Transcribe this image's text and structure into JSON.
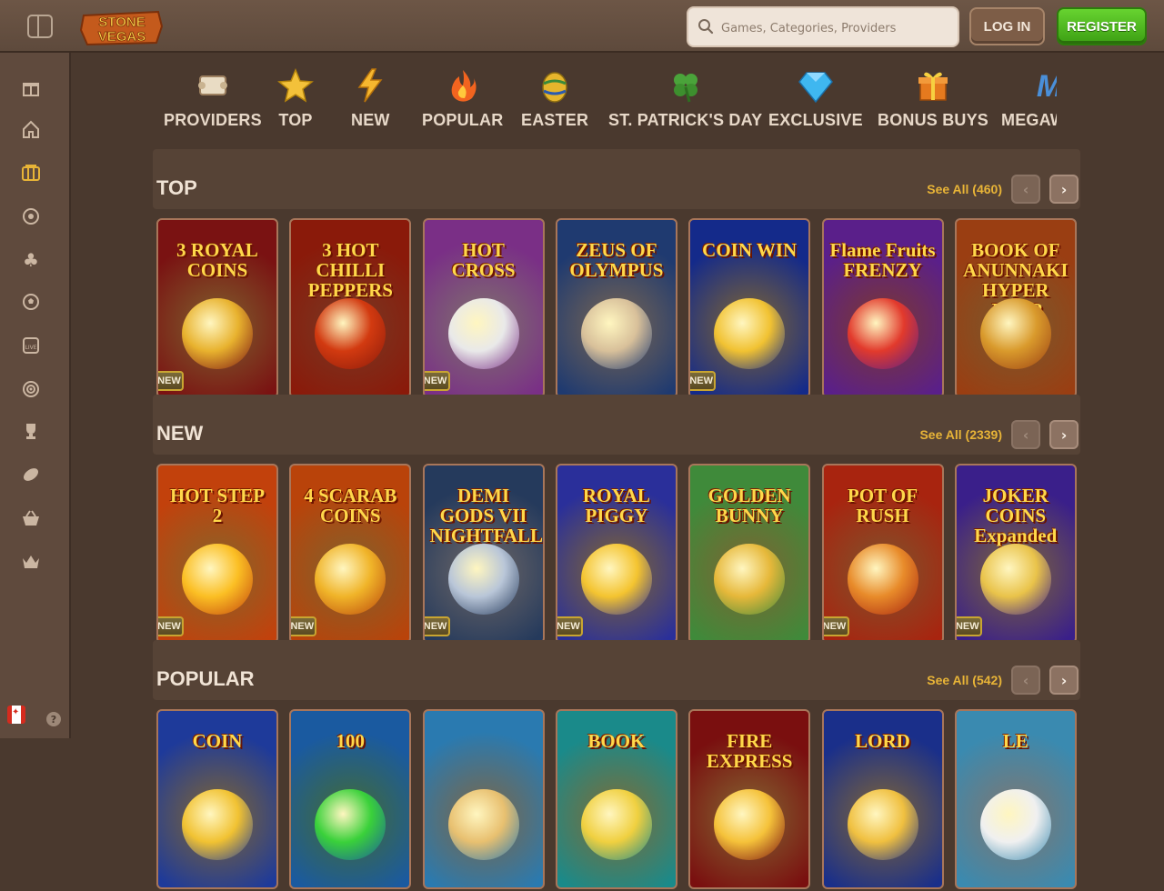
{
  "header": {
    "logo_text": "STONE VEGAS",
    "search_placeholder": "Games, Categories, Providers",
    "login_label": "LOG IN",
    "register_label": "REGISTER"
  },
  "sidebar": {
    "items": [
      {
        "name": "gift-icon"
      },
      {
        "name": "home-icon"
      },
      {
        "name": "slots-icon"
      },
      {
        "name": "roulette-icon"
      },
      {
        "name": "clover-icon"
      },
      {
        "name": "football-icon"
      },
      {
        "name": "live-casino-icon"
      },
      {
        "name": "target-icon"
      },
      {
        "name": "trophy-icon"
      },
      {
        "name": "rugby-icon"
      },
      {
        "name": "basket-icon"
      },
      {
        "name": "crown-icon"
      }
    ],
    "help_label": "?"
  },
  "categories": [
    {
      "label": "PROVIDERS",
      "icon": "scroll-icon"
    },
    {
      "label": "TOP",
      "icon": "star-icon"
    },
    {
      "label": "NEW",
      "icon": "lightning-icon"
    },
    {
      "label": "POPULAR",
      "icon": "fire-icon"
    },
    {
      "label": "EASTER",
      "icon": "egg-icon"
    },
    {
      "label": "ST. PATRICK'S DAY",
      "icon": "shamrock-icon"
    },
    {
      "label": "EXCLUSIVE",
      "icon": "diamond-icon"
    },
    {
      "label": "BONUS BUYS",
      "icon": "gift-box-icon"
    },
    {
      "label": "MEGAWAYS",
      "icon": "megaways-icon"
    }
  ],
  "sections": [
    {
      "title": "TOP",
      "see_all": "See All (460)",
      "games": [
        {
          "title": "3 ROYAL COINS",
          "badge": "NEW",
          "bg": "#7a1212",
          "accent": "#e8b22e"
        },
        {
          "title": "3 HOT CHILLI PEPPERS",
          "badge": "",
          "bg": "#8a1a0a",
          "accent": "#d23a10"
        },
        {
          "title": "HOT CROSS",
          "badge": "NEW",
          "bg": "#7a2f86",
          "accent": "#e9e9e9"
        },
        {
          "title": "ZEUS OF OLYMPUS",
          "badge": "",
          "bg": "#1f3a70",
          "accent": "#d8c09a"
        },
        {
          "title": "COIN WIN",
          "badge": "NEW",
          "bg": "#142a8a",
          "accent": "#f1c232"
        },
        {
          "title": "Flame Fruits FRENZY",
          "badge": "",
          "bg": "#5a1f8a",
          "accent": "#e23a2c"
        },
        {
          "title": "BOOK OF ANUNNAKI HYPER JUMP",
          "badge": "",
          "bg": "#9a3e12",
          "accent": "#d99a2c"
        }
      ]
    },
    {
      "title": "NEW",
      "see_all": "See All (2339)",
      "games": [
        {
          "title": "HOT STEP 2",
          "badge": "NEW",
          "bg": "#c2410c",
          "accent": "#fbbf24"
        },
        {
          "title": "4 SCARAB COINS",
          "badge": "NEW",
          "bg": "#b9430a",
          "accent": "#f0b429"
        },
        {
          "title": "DEMI GODS VII NIGHTFALL",
          "badge": "NEW",
          "bg": "#253a5c",
          "accent": "#b9c6d8"
        },
        {
          "title": "ROYAL PIGGY",
          "badge": "NEW",
          "bg": "#2a2f9a",
          "accent": "#f4c430"
        },
        {
          "title": "GOLDEN BUNNY",
          "badge": "",
          "bg": "#3f8a3a",
          "accent": "#e6b83a"
        },
        {
          "title": "POT OF RUSH",
          "badge": "NEW",
          "bg": "#a8240f",
          "accent": "#e88b2a"
        },
        {
          "title": "JOKER COINS Expanded",
          "badge": "NEW",
          "bg": "#3a1f8a",
          "accent": "#e9c34a"
        }
      ]
    },
    {
      "title": "POPULAR",
      "see_all": "See All (542)",
      "games": [
        {
          "title": "COIN",
          "badge": "",
          "bg": "#1e3a9a",
          "accent": "#f1c232"
        },
        {
          "title": "100",
          "badge": "",
          "bg": "#1a5aa0",
          "accent": "#3ad13a"
        },
        {
          "title": "",
          "badge": "",
          "bg": "#2a7ab0",
          "accent": "#e8c070"
        },
        {
          "title": "BOOK",
          "badge": "",
          "bg": "#1a8a8a",
          "accent": "#f0d040"
        },
        {
          "title": "FIRE EXPRESS",
          "badge": "",
          "bg": "#7a0f0f",
          "accent": "#f5c23a"
        },
        {
          "title": "LORD",
          "badge": "",
          "bg": "#1a2f8a",
          "accent": "#f0c040"
        },
        {
          "title": "LE",
          "badge": "",
          "bg": "#3a8ab0",
          "accent": "#f0f0f0"
        }
      ]
    }
  ]
}
